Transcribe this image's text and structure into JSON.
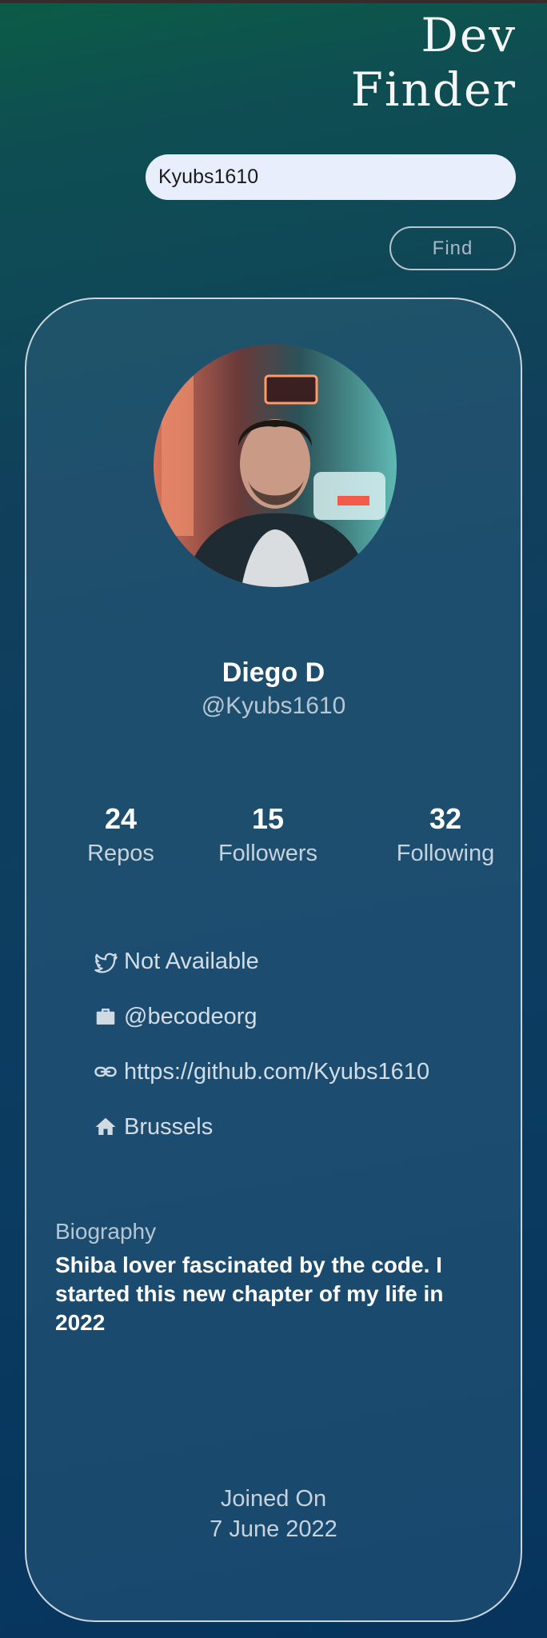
{
  "header": {
    "title_line1": "Dev",
    "title_line2": "Finder"
  },
  "search": {
    "value": "Kyubs1610",
    "button_label": "Find"
  },
  "profile": {
    "name": "Diego D",
    "username": "@Kyubs1610",
    "stats": [
      {
        "value": "24",
        "label": "Repos"
      },
      {
        "value": "15",
        "label": "Followers"
      },
      {
        "value": "32",
        "label": "Following"
      }
    ],
    "info": [
      {
        "icon": "twitter-icon",
        "text": "Not Available"
      },
      {
        "icon": "briefcase-icon",
        "text": "@becodeorg"
      },
      {
        "icon": "link-icon",
        "text": "https://github.com/Kyubs1610"
      },
      {
        "icon": "home-icon",
        "text": "Brussels"
      }
    ],
    "bio_heading": "Biography",
    "bio": "Shiba lover fascinated by the code. I started this new chapter of my life in 2022",
    "joined_label": "Joined On",
    "joined_date": "7 June 2022"
  },
  "colors": {
    "background_top": "#0b5c45",
    "background_bottom": "#06345d",
    "input_bg": "#e8eefb",
    "card_border": "#c9d6df"
  }
}
